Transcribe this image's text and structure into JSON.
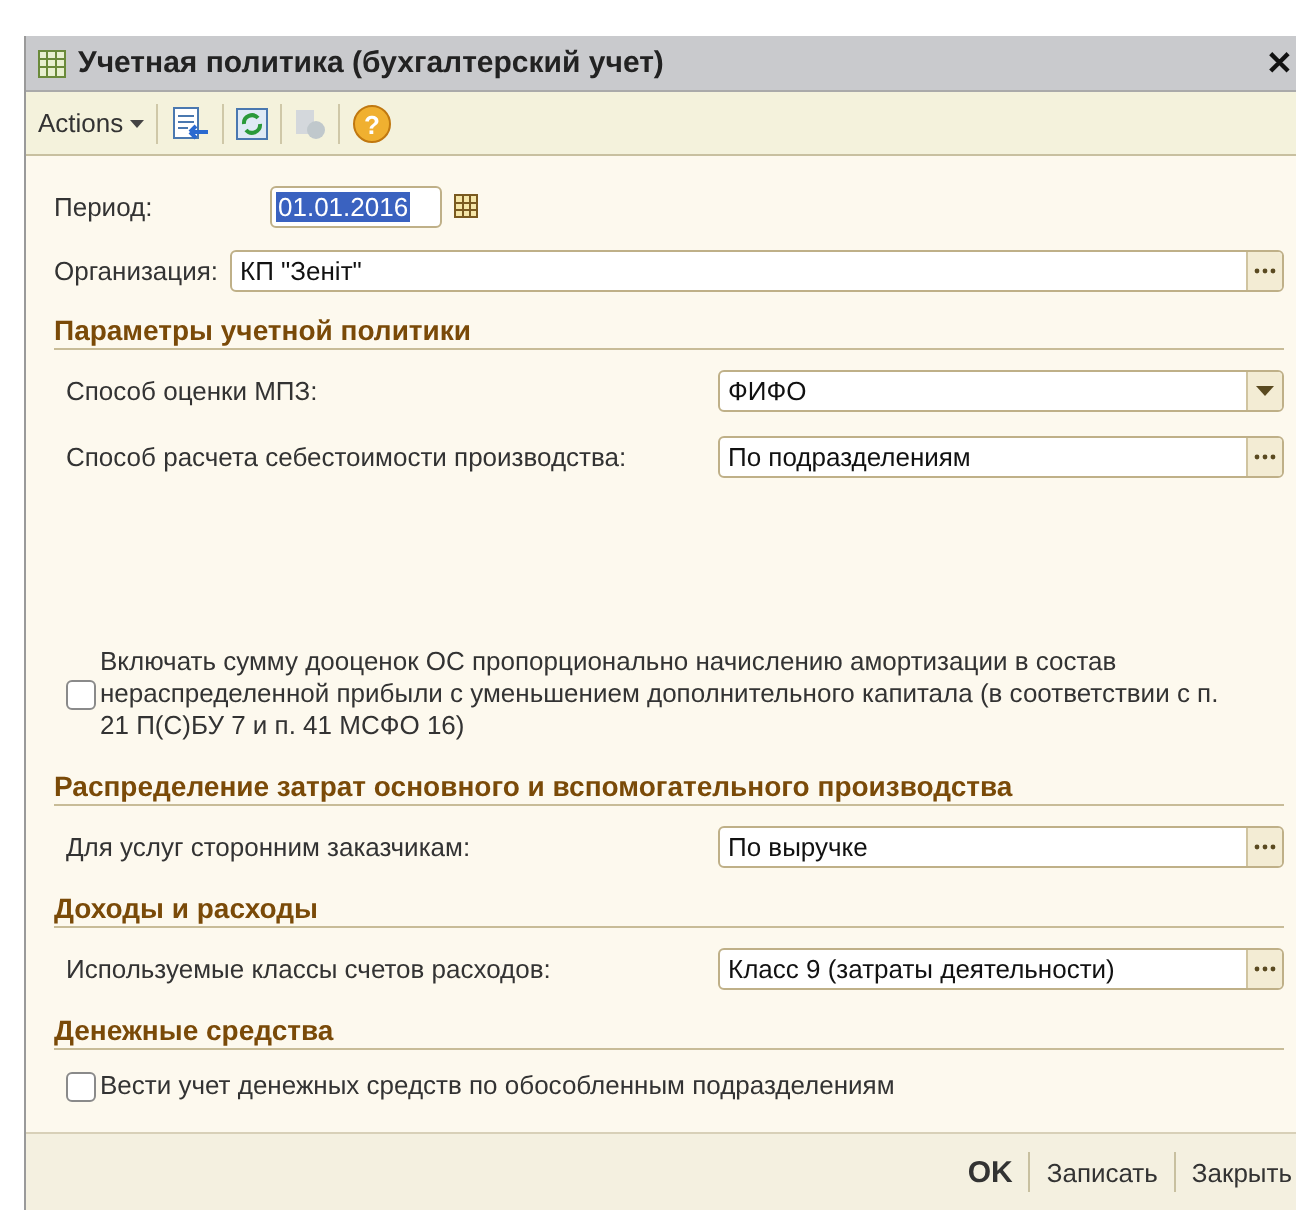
{
  "window": {
    "title": "Учетная политика (бухгалтерский учет)",
    "close": "✕"
  },
  "toolbar": {
    "actions_label": "Actions",
    "help_label": "?"
  },
  "period": {
    "label": "Период:",
    "value": "01.01.2016"
  },
  "organization": {
    "label": "Организация:",
    "value": "КП \"Зеніт\""
  },
  "sections": [
    {
      "title": "Параметры учетной политики",
      "rows": [
        {
          "kind": "select",
          "label": "Способ оценки МПЗ:",
          "value": "ФИФО"
        },
        {
          "kind": "choice",
          "label": "Способ расчета себестоимости производства:",
          "value": "По подразделениям"
        },
        {
          "kind": "spacer"
        },
        {
          "kind": "checkbox",
          "label": "Включать сумму дооценок ОС пропорционально начислению амортизации в состав нераспределенной прибыли с уменьшением дополнительного капитала (в соответствии с п. 21 П(С)БУ 7 и п. 41 МСФО 16)",
          "checked": false
        }
      ]
    },
    {
      "title": "Распределение затрат основного и вспомогательного производства",
      "rows": [
        {
          "kind": "choice",
          "label": "Для услуг сторонним заказчикам:",
          "value": "По выручке"
        }
      ]
    },
    {
      "title": "Доходы и расходы",
      "rows": [
        {
          "kind": "choice",
          "label": "Используемые классы счетов расходов:",
          "value": "Класс 9 (затраты деятельности)"
        }
      ]
    },
    {
      "title": "Денежные средства",
      "rows": [
        {
          "kind": "checkbox",
          "label": "Вести учет денежных средств по обособленным подразделениям",
          "checked": false
        }
      ]
    }
  ],
  "buttons": [
    {
      "label": "OK",
      "kind": "default"
    },
    {
      "label": "Записать",
      "kind": "normal"
    },
    {
      "label": "Закрыть",
      "kind": "normal"
    }
  ]
}
